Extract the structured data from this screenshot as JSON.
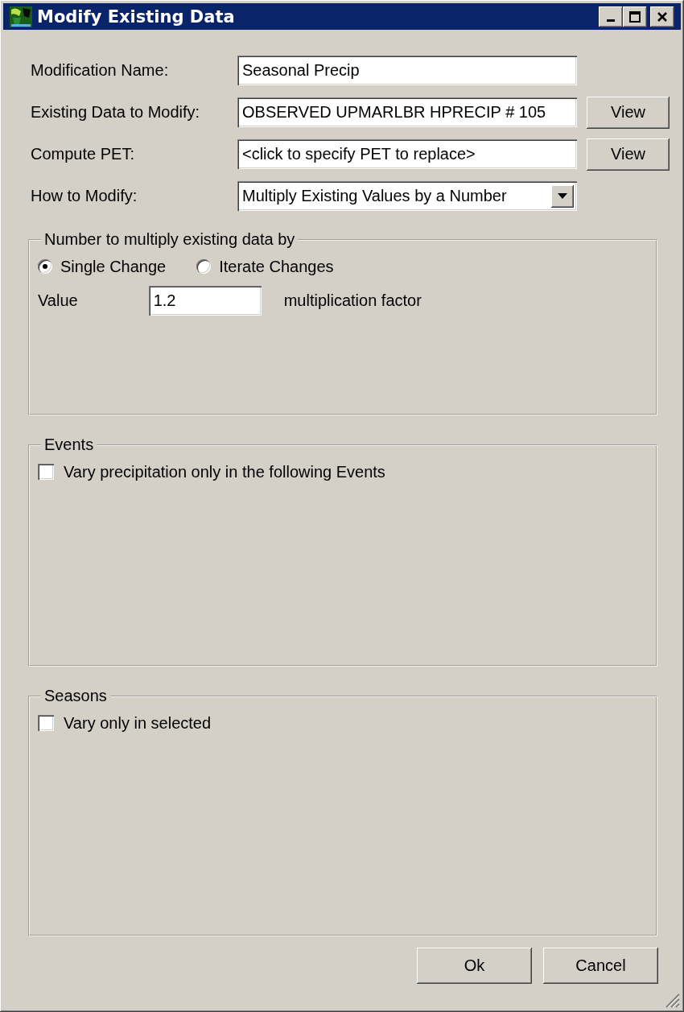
{
  "window": {
    "title": "Modify Existing Data"
  },
  "fields": [
    {
      "label": "Modification Name:",
      "kind": "text",
      "value": "Seasonal Precip"
    },
    {
      "label": "Existing Data to Modify:",
      "kind": "text",
      "value": "OBSERVED UPMARLBR HPRECIP # 105",
      "button": "View"
    },
    {
      "label": "Compute PET:",
      "kind": "text",
      "value": "<click to specify PET to replace>",
      "button": "View"
    },
    {
      "label": "How to Modify:",
      "kind": "dropdown",
      "value": "Multiply Existing Values by a Number"
    }
  ],
  "groups": [
    {
      "title": "Number to multiply existing data by",
      "kind": "factor",
      "options": [
        {
          "label": "Single Change",
          "selected": true
        },
        {
          "label": "Iterate Changes",
          "selected": false
        }
      ],
      "value_label": "Value",
      "value": "1.2",
      "unit": "multiplication factor"
    },
    {
      "title": "Events",
      "kind": "check",
      "check": {
        "label": "Vary precipitation only in the following Events",
        "checked": false
      }
    },
    {
      "title": "Seasons",
      "kind": "check",
      "check": {
        "label": "Vary only in selected",
        "checked": false
      }
    }
  ],
  "buttons": [
    "Ok",
    "Cancel"
  ]
}
